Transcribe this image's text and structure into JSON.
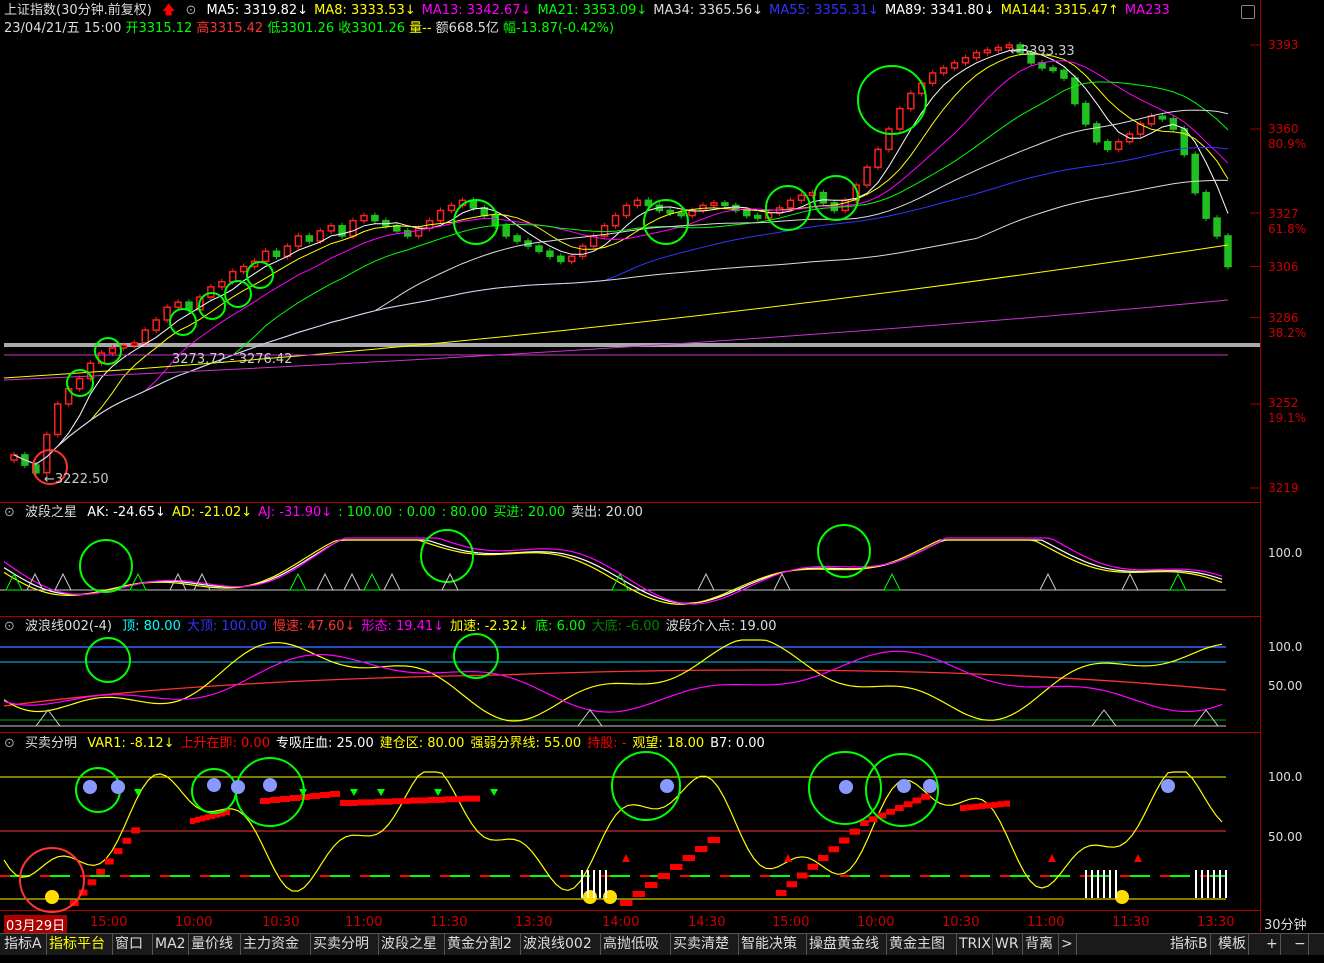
{
  "header": {
    "symbol": "上证指数(30分钟.前复权)",
    "ma": [
      {
        "label": "MA5: 3319.82↓",
        "color": "#ffffff"
      },
      {
        "label": "MA8: 3333.53↓",
        "color": "#ffff00"
      },
      {
        "label": "MA13: 3342.67↓",
        "color": "#ff00ff"
      },
      {
        "label": "MA21: 3353.09↓",
        "color": "#00ff00"
      },
      {
        "label": "MA34: 3365.56↓",
        "color": "#dddddd"
      },
      {
        "label": "MA55: 3355.31↓",
        "color": "#3333ff"
      },
      {
        "label": "MA89: 3341.80↓",
        "color": "#ffffff"
      },
      {
        "label": "MA144: 3315.47↑",
        "color": "#ffff00"
      },
      {
        "label": "MA233",
        "color": "#ff00ff"
      }
    ],
    "quote": {
      "date": "23/04/21/五 15:00",
      "open": "开3315.12",
      "high": "高3315.42",
      "low": "低3301.26",
      "close": "收3301.26",
      "volume": "量--",
      "amount": "额668.5亿",
      "change": "幅-13.87(-0.42%)"
    }
  },
  "main_axis": [
    "3393",
    "3360",
    "3327",
    "3306",
    "3286",
    "3252",
    "3219"
  ],
  "fib": [
    "80.9%",
    "61.8%",
    "38.2%",
    "19.1%"
  ],
  "annotations": {
    "high": "3393.33",
    "band": "3273.72 - 3276.42",
    "low": "3222.50"
  },
  "panel1": {
    "title": "波段之星",
    "items": [
      {
        "label": "AK: -24.65↓",
        "color": "#ffffff"
      },
      {
        "label": "AD: -21.02↓",
        "color": "#ffff00"
      },
      {
        "label": "AJ: -31.90↓",
        "color": "#ff00ff"
      },
      {
        "label": ": 100.00",
        "color": "#00ff00"
      },
      {
        "label": ": 0.00",
        "color": "#00ff00"
      },
      {
        "label": ": 80.00",
        "color": "#00ff00"
      },
      {
        "label": "买进: 20.00",
        "color": "#00ff00"
      },
      {
        "label": "卖出: 20.00",
        "color": "#dddddd"
      }
    ],
    "axis": [
      "100.0"
    ]
  },
  "panel2": {
    "title": "波浪线002(-4)",
    "items": [
      {
        "label": "顶: 80.00",
        "color": "#00ffff"
      },
      {
        "label": "大顶: 100.00",
        "color": "#3333ff"
      },
      {
        "label": "慢速: 47.60↓",
        "color": "#ff3333"
      },
      {
        "label": "形态: 19.41↓",
        "color": "#ff00ff"
      },
      {
        "label": "加速: -2.32↓",
        "color": "#ffff00"
      },
      {
        "label": "底: 6.00",
        "color": "#00ff00"
      },
      {
        "label": "大底: -6.00",
        "color": "#008800"
      },
      {
        "label": "波段介入点: 19.00",
        "color": "#dddddd"
      }
    ],
    "axis": [
      "100.0",
      "50.00"
    ]
  },
  "panel3": {
    "title": "买卖分明",
    "items": [
      {
        "label": "VAR1: -8.12↓",
        "color": "#ffff00"
      },
      {
        "label": "上升在即: 0.00",
        "color": "#ff0000"
      },
      {
        "label": "专吸庄血: 25.00",
        "color": "#ffffff"
      },
      {
        "label": "建仓区: 80.00",
        "color": "#ffff00"
      },
      {
        "label": "强弱分界线: 55.00",
        "color": "#ffff00"
      },
      {
        "label": "持股: -",
        "color": "#ff0000"
      },
      {
        "label": "观望: 18.00",
        "color": "#ffff00"
      },
      {
        "label": "B7: 0.00",
        "color": "#ffffff"
      }
    ],
    "axis": [
      "100.0",
      "50.00"
    ]
  },
  "xaxis": [
    "03月29日",
    "15:00",
    "10:00",
    "10:30",
    "11:00",
    "11:30",
    "13:30",
    "14:00",
    "14:30",
    "15:00",
    "10:00",
    "10:30",
    "11:00",
    "11:30",
    "13:30"
  ],
  "period": "30分钟",
  "tabs": [
    "指标A",
    "指标平台",
    "窗口",
    "MA2",
    "量价线",
    "主力资金",
    "买卖分明",
    "波段之星",
    "黄金分割2",
    "波浪线002",
    "高抛低吸",
    "买卖清楚",
    "智能决策",
    "操盘黄金线",
    "黄金主图",
    "TRIX",
    "WR",
    "背离",
    ">"
  ],
  "right_tabs": [
    "指标B",
    "模板",
    "+",
    "−"
  ],
  "active_tab": "指标平台"
}
